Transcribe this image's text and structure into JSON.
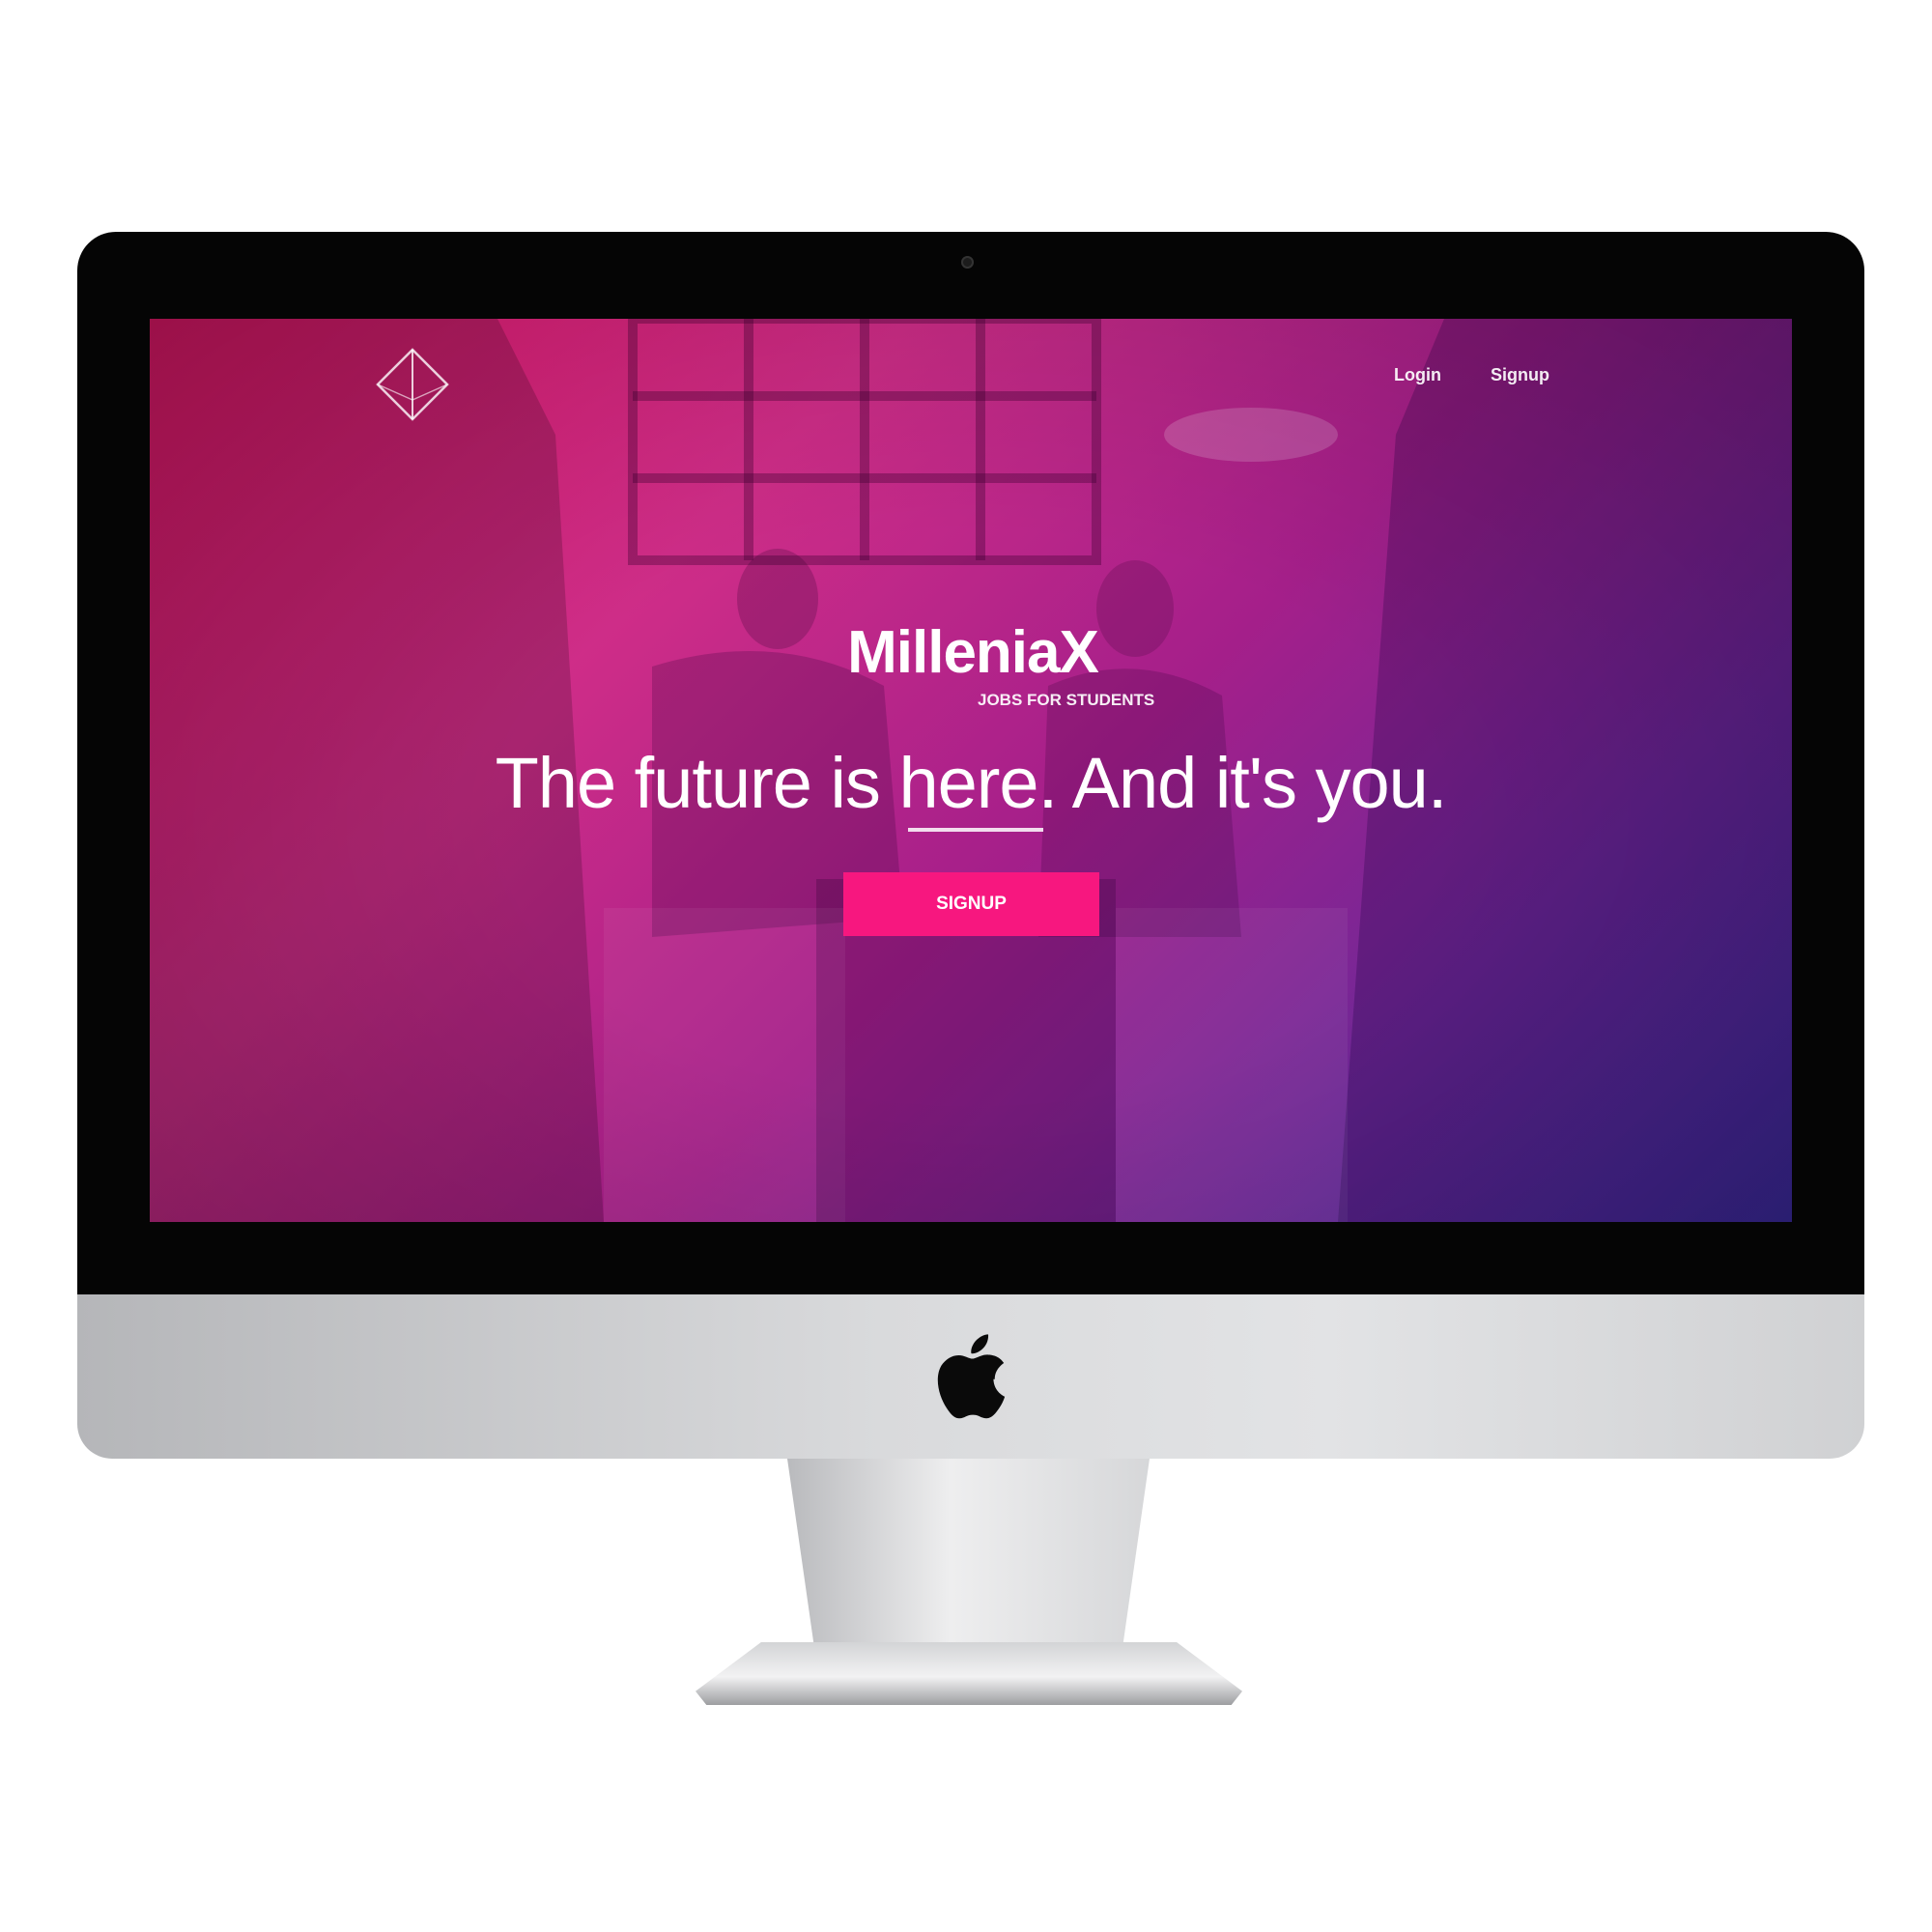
{
  "nav": {
    "login": "Login",
    "signup": "Signup"
  },
  "hero": {
    "title": "MilleniaX",
    "subtitle": "JOBS FOR STUDENTS",
    "headline_before": "The future is ",
    "headline_emphasis": "here",
    "headline_after": ". And it's you.",
    "cta_label": "SIGNUP"
  },
  "icons": {
    "brand_logo": "diamond-outline-icon",
    "hardware_logo": "apple-icon"
  },
  "colors": {
    "gradient_start": "#e8186c",
    "gradient_mid": "#a51f8a",
    "gradient_end": "#3c2f9e",
    "cta": "#f7177f",
    "text": "#ffffff"
  }
}
